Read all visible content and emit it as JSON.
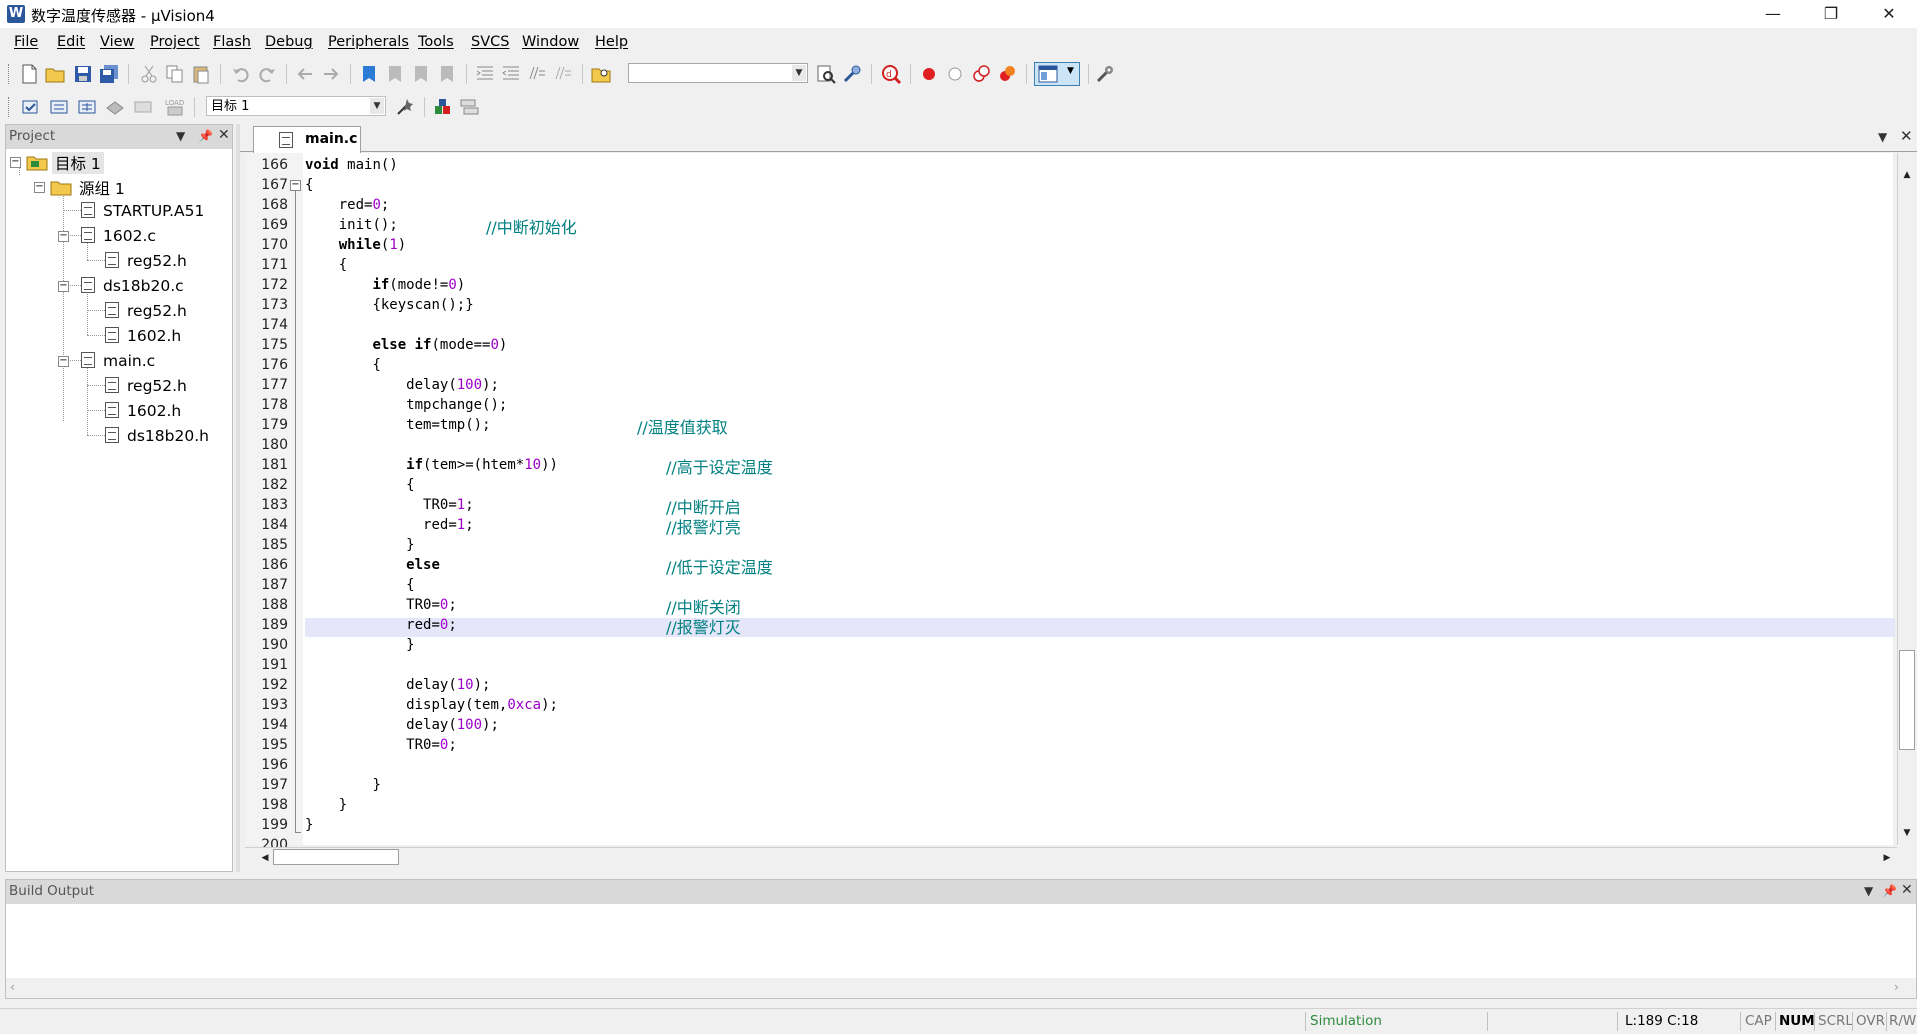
{
  "window": {
    "title": "数字温度传感器 - μVision4",
    "icon_letter": "W",
    "minimize": "—",
    "restore": "❐",
    "close": "✕"
  },
  "menu": [
    "File",
    "Edit",
    "View",
    "Project",
    "Flash",
    "Debug",
    "Peripherals",
    "Tools",
    "SVCS",
    "Window",
    "Help"
  ],
  "toolbar": {
    "find_combo_value": "",
    "target_combo_value": "目标 1"
  },
  "project_pane": {
    "title": "Project",
    "tree": [
      {
        "label": "目标 1",
        "level": 0,
        "type": "target"
      },
      {
        "label": "源组 1",
        "level": 1,
        "type": "folder"
      },
      {
        "label": "STARTUP.A51",
        "level": 2,
        "type": "file"
      },
      {
        "label": "1602.c",
        "level": 2,
        "type": "file"
      },
      {
        "label": "reg52.h",
        "level": 3,
        "type": "header"
      },
      {
        "label": "ds18b20.c",
        "level": 2,
        "type": "file"
      },
      {
        "label": "reg52.h",
        "level": 3,
        "type": "header"
      },
      {
        "label": "1602.h",
        "level": 3,
        "type": "header"
      },
      {
        "label": "main.c",
        "level": 2,
        "type": "file"
      },
      {
        "label": "reg52.h",
        "level": 3,
        "type": "header"
      },
      {
        "label": "1602.h",
        "level": 3,
        "type": "header"
      },
      {
        "label": "ds18b20.h",
        "level": 3,
        "type": "header"
      }
    ]
  },
  "editor": {
    "tab_label": "main.c",
    "current_line": "189",
    "lines": [
      {
        "n": "166",
        "code": "void main()"
      },
      {
        "n": "167",
        "code": "{"
      },
      {
        "n": "168",
        "code": "    red=0;"
      },
      {
        "n": "169",
        "code": "    init();",
        "comment": "//中断初始化"
      },
      {
        "n": "170",
        "code": "    while(1)"
      },
      {
        "n": "171",
        "code": "    {"
      },
      {
        "n": "172",
        "code": "        if(mode!=0)"
      },
      {
        "n": "173",
        "code": "        {keyscan();}"
      },
      {
        "n": "174",
        "code": ""
      },
      {
        "n": "175",
        "code": "        else if(mode==0)"
      },
      {
        "n": "176",
        "code": "        {"
      },
      {
        "n": "177",
        "code": "            delay(100);"
      },
      {
        "n": "178",
        "code": "            tmpchange();"
      },
      {
        "n": "179",
        "code": "            tem=tmp();",
        "comment": "//温度值获取"
      },
      {
        "n": "180",
        "code": ""
      },
      {
        "n": "181",
        "code": "            if(tem>=(htem*10))",
        "comment": "//高于设定温度"
      },
      {
        "n": "182",
        "code": "            {"
      },
      {
        "n": "183",
        "code": "              TR0=1;",
        "comment": "//中断开启"
      },
      {
        "n": "184",
        "code": "              red=1;",
        "comment": "//报警灯亮"
      },
      {
        "n": "185",
        "code": "            }"
      },
      {
        "n": "186",
        "code": "            else",
        "comment": "//低于设定温度"
      },
      {
        "n": "187",
        "code": "            {"
      },
      {
        "n": "188",
        "code": "            TR0=0;",
        "comment": "//中断关闭"
      },
      {
        "n": "189",
        "code": "            red=0;",
        "comment": "//报警灯灭"
      },
      {
        "n": "190",
        "code": "            }"
      },
      {
        "n": "191",
        "code": ""
      },
      {
        "n": "192",
        "code": "            delay(10);"
      },
      {
        "n": "193",
        "code": "            display(tem,0xca);"
      },
      {
        "n": "194",
        "code": "            delay(100);"
      },
      {
        "n": "195",
        "code": "            TR0=0;"
      },
      {
        "n": "196",
        "code": ""
      },
      {
        "n": "197",
        "code": "        }"
      },
      {
        "n": "198",
        "code": "    }"
      },
      {
        "n": "199",
        "code": "}"
      },
      {
        "n": "200",
        "code": ""
      }
    ]
  },
  "build_output": {
    "title": "Build Output",
    "content": ""
  },
  "statusbar": {
    "mode": "Simulation",
    "position": "L:189 C:18",
    "indicators": [
      "CAP",
      "NUM",
      "SCRL",
      "OVR",
      "R/W"
    ]
  },
  "colors": {
    "keyword": "#000000",
    "number": "#9c00c8",
    "comment": "#008080",
    "current_line": "#e6e6fa"
  }
}
